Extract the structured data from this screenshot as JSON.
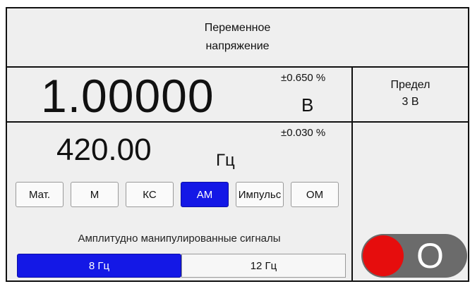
{
  "mode": {
    "line1": "Переменное",
    "line2": "напряжение"
  },
  "measurement": {
    "value": "1.00000",
    "accuracy": "±0.650  %",
    "unit": "В"
  },
  "frequency": {
    "value": "420.00",
    "unit": "Гц",
    "accuracy": "±0.030  %"
  },
  "modulation_buttons": [
    {
      "label": "Мат.",
      "active": false
    },
    {
      "label": "М",
      "active": false
    },
    {
      "label": "КС",
      "active": false
    },
    {
      "label": "АМ",
      "active": true
    },
    {
      "label": "Импульс",
      "active": false
    },
    {
      "label": "ОМ",
      "active": false
    }
  ],
  "modulation_description": "Амплитудно манипулированные сигналы",
  "sub_buttons": [
    {
      "label": "8 Гц",
      "active": true
    },
    {
      "label": "12 Гц",
      "active": false
    }
  ],
  "range": {
    "title": "Предел",
    "value": "3 В"
  },
  "output_toggle": {
    "label": "O",
    "state": "off",
    "knob_color": "#e60d0d"
  },
  "colors": {
    "accent": "#1418e6",
    "background": "#efefef"
  }
}
